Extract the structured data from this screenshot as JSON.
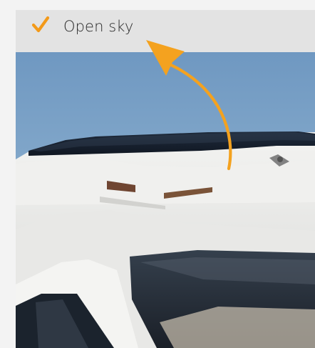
{
  "header": {
    "label": "Open sky",
    "check_icon": "check-icon",
    "check_color": "#f39a1a"
  },
  "photo": {
    "icon": "camper-roof-photo"
  },
  "arrow": {
    "icon": "curved-arrow-icon",
    "color": "#f4a21f"
  }
}
